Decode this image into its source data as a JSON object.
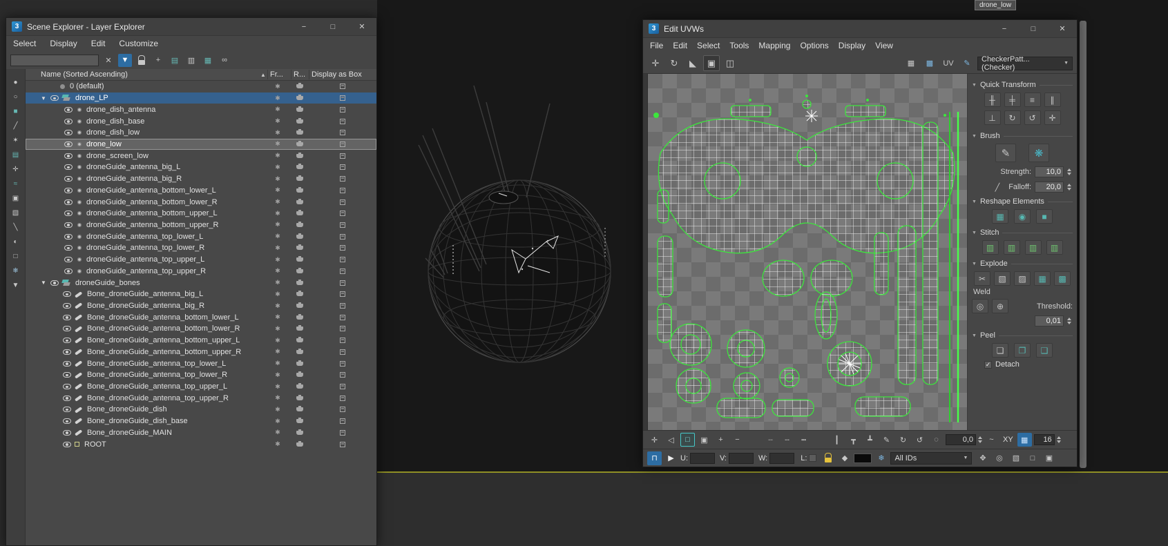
{
  "glyphs": {
    "dropdown_arrow": "▼",
    "section_arrow": "▼",
    "check": "✓"
  },
  "viewport": {
    "tooltip": "drone_low"
  },
  "scene_explorer": {
    "title": "Scene Explorer - Layer Explorer",
    "window_buttons": {
      "minimize": "−",
      "maximize": "□",
      "close": "✕"
    },
    "menu": [
      {
        "label": "Select"
      },
      {
        "label": "Display"
      },
      {
        "label": "Edit"
      },
      {
        "label": "Customize"
      }
    ],
    "search": {
      "value": "",
      "placeholder": ""
    },
    "toolbar_icons": [
      {
        "name": "clear-search-icon",
        "glyph": "✕"
      },
      {
        "name": "filter-icon",
        "glyph": "▼",
        "state": "active"
      },
      {
        "name": "lock-cell-editing-icon",
        "glyph": "",
        "css": "lock"
      },
      {
        "name": "create-new-layer-icon",
        "glyph": "+"
      },
      {
        "name": "make-layer-active-icon",
        "glyph": "▤",
        "color": "#66b8b4"
      },
      {
        "name": "add-selection-to-layer-icon",
        "glyph": "▥"
      },
      {
        "name": "select-layer-objects-icon",
        "glyph": "▦",
        "color": "#66b8b4"
      },
      {
        "name": "link-layers-icon",
        "glyph": "∞"
      }
    ],
    "left_toolbar_icons": [
      {
        "name": "display-all-icon",
        "glyph": "●"
      },
      {
        "name": "display-none-icon",
        "glyph": "○"
      },
      {
        "name": "display-geometry-icon",
        "glyph": "■",
        "color": "#66b8b4"
      },
      {
        "name": "display-shapes-icon",
        "glyph": "╱"
      },
      {
        "name": "display-lights-icon",
        "glyph": "✶"
      },
      {
        "name": "display-cameras-icon",
        "glyph": "▤",
        "color": "#66b8b4"
      },
      {
        "name": "display-helpers-icon",
        "glyph": "✛"
      },
      {
        "name": "display-spacewarps-icon",
        "glyph": "≈",
        "color": "#66b8b4"
      },
      {
        "name": "display-groups-icon",
        "glyph": "▣"
      },
      {
        "name": "display-xrefs-icon",
        "glyph": "▧"
      },
      {
        "name": "display-bones-icon",
        "glyph": "╲",
        "color": "#c9c9c9"
      },
      {
        "name": "display-materials-icon",
        "glyph": "◐"
      },
      {
        "name": "display-containers-icon",
        "glyph": "□"
      },
      {
        "name": "display-frozen-icon",
        "glyph": "❄",
        "color": "#9ec6e0"
      },
      {
        "name": "display-filter-icon",
        "glyph": "▼"
      }
    ],
    "tree_glyphs": {
      "expanded": "▼",
      "sort_asc": "▲",
      "frozen": "✱"
    },
    "columns": {
      "name": "Name (Sorted Ascending)",
      "frozen": "Fr...",
      "render": "R...",
      "box": "Display as Box"
    },
    "rows": [
      {
        "label": "0 (default)",
        "type": "layer-default"
      },
      {
        "label": "drone_LP",
        "type": "layer",
        "state": "sel-blue"
      },
      {
        "label": "drone_dish_antenna",
        "type": "object"
      },
      {
        "label": "drone_dish_base",
        "type": "object"
      },
      {
        "label": "drone_dish_low",
        "type": "object"
      },
      {
        "label": "drone_low",
        "type": "object",
        "state": "sel-gray"
      },
      {
        "label": "drone_screen_low",
        "type": "object"
      },
      {
        "label": "droneGuide_antenna_big_L",
        "type": "object"
      },
      {
        "label": "droneGuide_antenna_big_R",
        "type": "object"
      },
      {
        "label": "droneGuide_antenna_bottom_lower_L",
        "type": "object"
      },
      {
        "label": "droneGuide_antenna_bottom_lower_R",
        "type": "object"
      },
      {
        "label": "droneGuide_antenna_bottom_upper_L",
        "type": "object"
      },
      {
        "label": "droneGuide_antenna_bottom_upper_R",
        "type": "object"
      },
      {
        "label": "droneGuide_antenna_top_lower_L",
        "type": "object"
      },
      {
        "label": "droneGuide_antenna_top_lower_R",
        "type": "object"
      },
      {
        "label": "droneGuide_antenna_top_upper_L",
        "type": "object"
      },
      {
        "label": "droneGuide_antenna_top_upper_R",
        "type": "object"
      },
      {
        "label": "droneGuide_bones",
        "type": "layer"
      },
      {
        "label": "Bone_droneGuide_antenna_big_L",
        "type": "bone"
      },
      {
        "label": "Bone_droneGuide_antenna_big_R",
        "type": "bone"
      },
      {
        "label": "Bone_droneGuide_antenna_bottom_lower_L",
        "type": "bone"
      },
      {
        "label": "Bone_droneGuide_antenna_bottom_lower_R",
        "type": "bone"
      },
      {
        "label": "Bone_droneGuide_antenna_bottom_upper_L",
        "type": "bone"
      },
      {
        "label": "Bone_droneGuide_antenna_bottom_upper_R",
        "type": "bone"
      },
      {
        "label": "Bone_droneGuide_antenna_top_lower_L",
        "type": "bone"
      },
      {
        "label": "Bone_droneGuide_antenna_top_lower_R",
        "type": "bone"
      },
      {
        "label": "Bone_droneGuide_antenna_top_upper_L",
        "type": "bone"
      },
      {
        "label": "Bone_droneGuide_antenna_top_upper_R",
        "type": "bone"
      },
      {
        "label": "Bone_droneGuide_dish",
        "type": "bone"
      },
      {
        "label": "Bone_droneGuide_dish_base",
        "type": "bone"
      },
      {
        "label": "Bone_droneGuide_MAIN",
        "type": "bone"
      },
      {
        "label": "ROOT",
        "type": "root"
      }
    ]
  },
  "edit_uvws": {
    "title": "Edit UVWs",
    "window_buttons": {
      "minimize": "−",
      "maximize": "□",
      "close": "✕"
    },
    "menu": [
      {
        "label": "File"
      },
      {
        "label": "Edit"
      },
      {
        "label": "Select"
      },
      {
        "label": "Tools"
      },
      {
        "label": "Mapping"
      },
      {
        "label": "Options"
      },
      {
        "label": "Display"
      },
      {
        "label": "View"
      }
    ],
    "toolbar": {
      "left_icons": [
        {
          "name": "move-icon",
          "glyph": "✛"
        },
        {
          "name": "rotate-icon",
          "glyph": "↻"
        },
        {
          "name": "scale-icon",
          "glyph": "◣"
        },
        {
          "name": "freeform-mode-icon",
          "glyph": "▣",
          "state": "pressed"
        },
        {
          "name": "mirror-icon",
          "glyph": "◫"
        }
      ],
      "right_icons": [
        {
          "name": "show-map-icon",
          "glyph": "▦"
        },
        {
          "name": "snap-settings-icon",
          "glyph": "▩",
          "color": "#7db6e0"
        },
        {
          "name": "uv-channel-label",
          "glyph": "UV"
        },
        {
          "name": "sketch-brush-icon",
          "glyph": "✎",
          "color": "#7db6e0"
        }
      ],
      "texture_dropdown": "CheckerPatt...(Checker)"
    },
    "panels": {
      "quick_transform": {
        "title": "Quick Transform",
        "icons": [
          {
            "name": "align-horizontal-icon",
            "glyph": "╫"
          },
          {
            "name": "align-vertical-icon",
            "glyph": "╪"
          },
          {
            "name": "linear-align-icon",
            "glyph": "≡"
          },
          {
            "name": "space-horizontally-icon",
            "glyph": "∥"
          },
          {
            "name": "align-to-edge-icon",
            "glyph": "⊥"
          },
          {
            "name": "rotate-90-cw-icon",
            "glyph": "↻"
          },
          {
            "name": "rotate-90-ccw-icon",
            "glyph": "↺"
          },
          {
            "name": "freeform-gizmo-icon",
            "glyph": "✛"
          }
        ]
      },
      "brush": {
        "title": "Brush",
        "icons": [
          {
            "name": "paint-move-brush-icon",
            "glyph": "✎"
          },
          {
            "name": "relax-brush-icon",
            "glyph": "❋",
            "color": "#49b8c8"
          }
        ],
        "strength_label": "Strength:",
        "strength_value": "10,0",
        "falloff_label": "Falloff:",
        "falloff_value": "20,0",
        "falloff_curve_glyph": "╱"
      },
      "reshape": {
        "title": "Reshape Elements",
        "icons": [
          {
            "name": "straighten-selection-icon",
            "glyph": "▦",
            "color": "#57b8b2"
          },
          {
            "name": "relax-element-icon",
            "glyph": "◉",
            "color": "#57b8b2"
          },
          {
            "name": "rectangularize-icon",
            "glyph": "■",
            "color": "#57b8b2"
          }
        ]
      },
      "stitch": {
        "title": "Stitch",
        "icons": [
          {
            "name": "stitch-custom-icon",
            "glyph": "▥",
            "color": "#6fc46f"
          },
          {
            "name": "stitch-source-icon",
            "glyph": "▥",
            "color": "#6fc46f"
          },
          {
            "name": "stitch-average-icon",
            "glyph": "▥",
            "color": "#6fc46f"
          },
          {
            "name": "stitch-target-icon",
            "glyph": "▥",
            "color": "#6fc46f"
          }
        ]
      },
      "explode": {
        "title": "Explode",
        "icons": [
          {
            "name": "break-icon",
            "glyph": "✂"
          },
          {
            "name": "explode-by-smoothing-icon",
            "glyph": "▧"
          },
          {
            "name": "explode-by-material-icon",
            "glyph": "▨"
          },
          {
            "name": "flatten-mapping-icon",
            "glyph": "▦",
            "color": "#57b8b2"
          },
          {
            "name": "flatten-custom-icon",
            "glyph": "▩",
            "color": "#57b8b2"
          }
        ],
        "weld_label": "Weld",
        "weld_icons": [
          {
            "name": "weld-selected-icon",
            "glyph": "◎"
          },
          {
            "name": "target-weld-icon",
            "glyph": "⊕"
          }
        ],
        "threshold_label": "Threshold:",
        "threshold_value": "0,01"
      },
      "peel": {
        "title": "Peel",
        "icons": [
          {
            "name": "quick-peel-icon",
            "glyph": "❏"
          },
          {
            "name": "peel-mode-icon",
            "glyph": "❐",
            "color": "#57b8b2"
          },
          {
            "name": "edit-seams-icon",
            "glyph": "❑",
            "color": "#57b8b2"
          }
        ],
        "detach_label": "Detach"
      }
    },
    "bottom_bar1": {
      "icons": [
        {
          "name": "soft-selection-icon",
          "glyph": "✛"
        },
        {
          "name": "paint-soft-selection-icon",
          "glyph": "◁"
        },
        {
          "name": "subobject-square-icon",
          "glyph": "□",
          "state": "active-teal"
        },
        {
          "name": "element-mode-icon",
          "glyph": "▣"
        },
        {
          "name": "grow-selection-icon",
          "glyph": "+"
        },
        {
          "name": "shrink-selection-icon",
          "glyph": "−"
        },
        {
          "kind": "sep"
        },
        {
          "name": "select-loop-icon",
          "glyph": "┈"
        },
        {
          "name": "select-ring-icon",
          "glyph": "╌"
        },
        {
          "name": "select-edge-loop-icon",
          "glyph": "┅"
        },
        {
          "kind": "sep"
        },
        {
          "name": "edge-vertical-icon",
          "glyph": "┃"
        },
        {
          "name": "align-to-top-icon",
          "glyph": "┳"
        },
        {
          "name": "align-to-bottom-icon",
          "glyph": "┻"
        },
        {
          "name": "paint-brush-icon",
          "glyph": "✎"
        },
        {
          "name": "relax-cw-icon",
          "glyph": "↻"
        },
        {
          "name": "relax-ccw-icon",
          "glyph": "↺"
        },
        {
          "name": "pivot-marker-icon",
          "glyph": "◌"
        }
      ],
      "rotate_value": "0,0",
      "curve_icon_glyph": "~",
      "axis_label": "XY",
      "grid_icon": {
        "name": "grid-snap-icon",
        "glyph": "▦",
        "state": "active-blue"
      },
      "grid_value": "16"
    },
    "bottom_bar2": {
      "magnet_glyph": "⊓",
      "absolute_glyph": "▶",
      "u_label": "U:",
      "v_label": "V:",
      "w_label": "W:",
      "l_label": "L:",
      "u_value": "",
      "v_value": "",
      "w_value": "",
      "filter_glyph": "◆",
      "freeze_glyph": "❄",
      "ids_dropdown": "All IDs",
      "nav_icons": [
        {
          "name": "pan-icon",
          "glyph": "✥"
        },
        {
          "name": "zoom-icon",
          "glyph": "◎"
        },
        {
          "name": "zoom-region-icon",
          "glyph": "▧"
        },
        {
          "name": "zoom-extents-icon",
          "glyph": "□"
        },
        {
          "name": "zoom-selected-icon",
          "glyph": "▣"
        }
      ]
    }
  }
}
